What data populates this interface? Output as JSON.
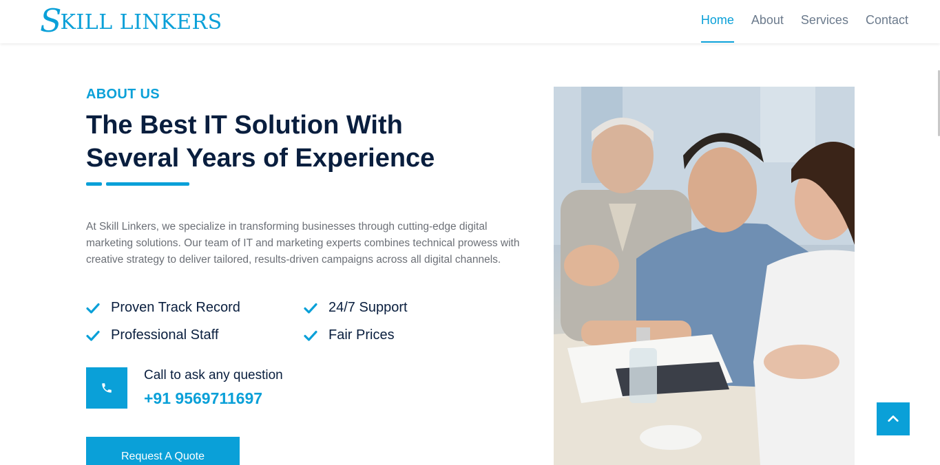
{
  "brand": {
    "logo_initial": "S",
    "logo_rest": "KILL LINKERS",
    "color": "#0aa0d8"
  },
  "nav": {
    "items": [
      "Home",
      "About",
      "Services",
      "Contact"
    ],
    "active": "Home"
  },
  "about": {
    "eyebrow": "ABOUT US",
    "title_line1": "The Best IT Solution With",
    "title_line2": "Several Years of Experience",
    "paragraph": "At Skill Linkers, we specialize in transforming businesses through cutting-edge digital marketing solutions. Our team of IT and marketing experts combines technical prowess with creative strategy to deliver tailored, results-driven campaigns across all digital channels.",
    "features": [
      "Proven Track Record",
      "24/7 Support",
      "Professional Staff",
      "Fair Prices"
    ],
    "call_label": "Call to ask any question",
    "call_number": "+91 9569711697",
    "quote_button": "Request A Quote"
  },
  "icons": {
    "feature": "check-icon",
    "call": "phone-icon",
    "scroll_top": "chevron-up-icon"
  },
  "colors": {
    "accent": "#0aa0d8",
    "heading": "#091e3e",
    "body_text": "#6b6f76",
    "nav_text": "#6b7a8c"
  }
}
